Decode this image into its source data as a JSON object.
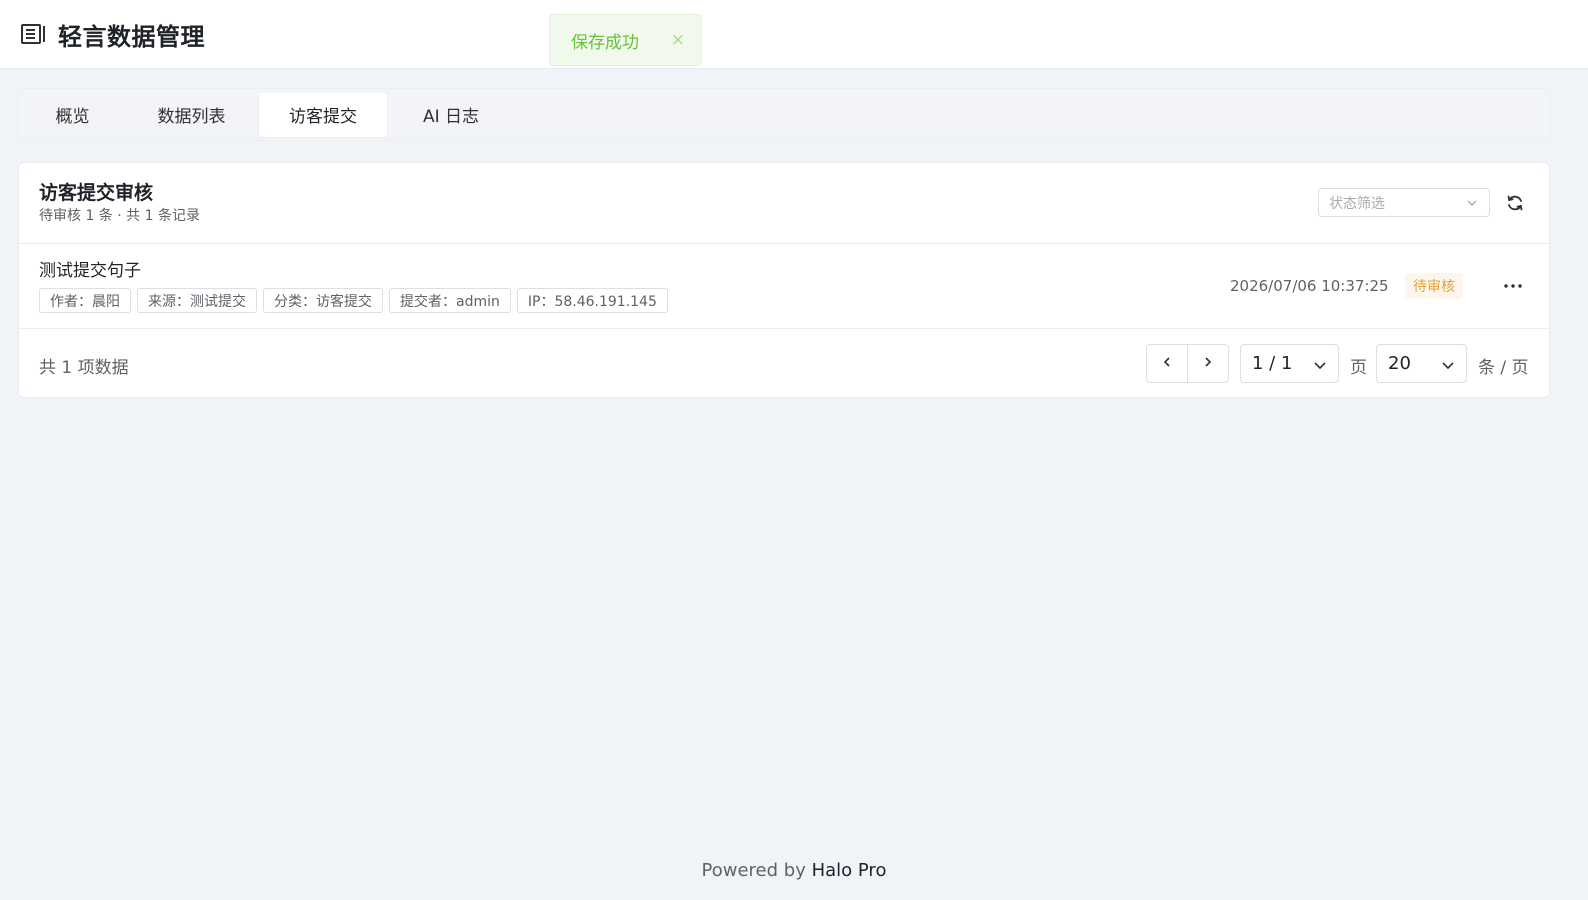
{
  "app": {
    "title": "轻言数据管理",
    "logo_icon": "book-list-icon"
  },
  "toast": {
    "message": "保存成功",
    "close_symbol": "×",
    "color": "#67c23a"
  },
  "tabs": [
    {
      "label": "概览",
      "active": false
    },
    {
      "label": "数据列表",
      "active": false
    },
    {
      "label": "访客提交",
      "active": true
    },
    {
      "label": "AI 日志",
      "active": false
    }
  ],
  "card": {
    "title": "访客提交审核",
    "subtitle": "待审核 1 条 · 共 1 条记录",
    "filter_placeholder": "状态筛选"
  },
  "submissions": [
    {
      "title": "测试提交句子",
      "tags": [
        "作者：晨阳",
        "来源：测试提交",
        "分类：访客提交",
        "提交者：admin",
        "IP：58.46.191.145"
      ],
      "time": "2026/07/06 10:37:25",
      "status": "待审核",
      "status_color": "#e6a23c"
    }
  ],
  "pagination": {
    "total_text": "共 1 项数据",
    "page_value": "1 / 1",
    "page_unit": "页",
    "size_value": "20",
    "size_unit": "条 / 页"
  },
  "footer": {
    "prefix": "Powered by ",
    "brand": "Halo Pro"
  }
}
